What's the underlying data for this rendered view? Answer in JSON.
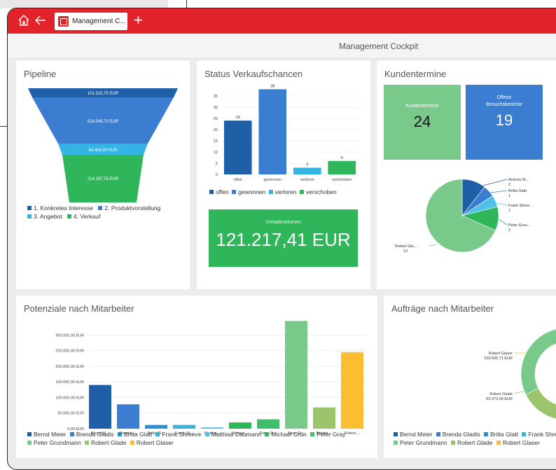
{
  "window": {
    "tab_label": "Management C...",
    "page_title": "Management Cockpit"
  },
  "colors": {
    "brand_red": "#e2232a",
    "dark_blue": "#1f5fa8",
    "mid_blue": "#3b7dd0",
    "cyan": "#33b4e3",
    "green": "#2fb55a",
    "light_green": "#79c98a",
    "olive_green": "#9cc46b",
    "orange": "#fbbd32"
  },
  "icons": [
    "home-icon",
    "back-arrow-icon",
    "app-tab-icon",
    "add-tab-icon"
  ],
  "pipeline": {
    "title": "Pipeline",
    "stages": [
      {
        "label": "101.315,75 EUR",
        "legend": "1. Konkretes Interesse"
      },
      {
        "label": "518.549,70 EUR",
        "legend": "2. Produktvorstellung"
      },
      {
        "label": "94.454,90 EUR",
        "legend": "3. Angebot"
      },
      {
        "label": "214.167,76 EUR",
        "legend": "4. Verkauf"
      }
    ]
  },
  "status": {
    "title": "Status Verkaufschancen"
  },
  "umsatz": {
    "label": "Umsatzvolumen",
    "value": "121.217,41 EUR"
  },
  "termine": {
    "title": "Kundentermine",
    "tile1_label": "Kundentermine",
    "tile1_value": "24",
    "tile2_label": "Offene Besuchsberichte",
    "tile2_value": "19",
    "pie_labels": [
      {
        "name": "Antonio M...",
        "value": "2"
      },
      {
        "name": "Britta Glatt",
        "value": "1"
      },
      {
        "name": "Frank Shree...",
        "value": "1"
      },
      {
        "name": "Peter Grun...",
        "value": "2"
      },
      {
        "name": "Robert Gla...",
        "value": "13"
      }
    ]
  },
  "potenziale": {
    "title": "Potenziale nach Mitarbeiter"
  },
  "auftraege": {
    "title": "Aufträge nach Mitarbeiter",
    "callout1_name": "Robert Glaser",
    "callout1_value": "239.605,71 EUR",
    "callout2_name": "Robert Glade",
    "callout2_value": "65.973,00 EUR",
    "legend": [
      {
        "name": "Bernd Meier",
        "color": "#1f5fa8"
      },
      {
        "name": "Brenda Gladis",
        "color": "#3b7dd0"
      },
      {
        "name": "Britta Glatt",
        "color": "#2b8fd8"
      },
      {
        "name": "Frank Shreeve",
        "color": "#33b4e3"
      },
      {
        "name": "Peter Grundmann",
        "color": "#79c98a"
      },
      {
        "name": "Robert Glade",
        "color": "#9cc46b"
      },
      {
        "name": "Robert Glaser",
        "color": "#fbbd32"
      }
    ]
  },
  "chart_data": [
    {
      "type": "bar",
      "title": "Status Verkaufschancen",
      "categories": [
        "offen",
        "gewonnen",
        "verloren",
        "verschoben"
      ],
      "values": [
        24,
        38,
        3,
        6
      ],
      "colors": [
        "#1f5fa8",
        "#3b7dd0",
        "#33b4e3",
        "#2fb55a"
      ],
      "yticks": [
        0,
        5,
        10,
        15,
        20,
        25,
        30,
        35
      ],
      "ylim": [
        0,
        40
      ],
      "legend": [
        "offen",
        "gewonnen",
        "verloren",
        "verschoben"
      ],
      "legend_position": "bottom"
    },
    {
      "type": "bar",
      "title": "Potenziale nach Mitarbeiter",
      "categories": [
        "Bernd M...",
        "Brenda ...",
        "Britta Gl...",
        "Frank Sh...",
        "Matthia...",
        "Michael ...",
        "Peter Gr...",
        "Peter Gr...",
        "Robert ...",
        "Robert ..."
      ],
      "values": [
        140000,
        78000,
        12000,
        12000,
        4000,
        20000,
        30000,
        345000,
        68000,
        245000
      ],
      "colors": [
        "#1f5fa8",
        "#3b7dd0",
        "#2b8fd8",
        "#33b4e3",
        "#4fc1e9",
        "#2fb55a",
        "#3fbf6a",
        "#79c98a",
        "#9cc46b",
        "#fbbd32"
      ],
      "yticks": [
        "0,00 EUR",
        "50.000,00 EUR",
        "100.000,00 EUR",
        "150.000,00 EUR",
        "200.000,00 EUR",
        "250.000,00 EUR",
        "300.000,00 EUR"
      ],
      "ylim": [
        0,
        350000
      ],
      "legend": [
        "Bernd Meier",
        "Brenda Gladis",
        "Britta Glatt",
        "Frank Shreeve",
        "Matthias Daumann",
        "Michael Grün",
        "Peter Gray",
        "Peter Grundmann",
        "Robert Glade",
        "Robert Glaser"
      ],
      "legend_position": "bottom"
    },
    {
      "type": "pie",
      "title": "Kundentermine",
      "labels": [
        "Antonio M...",
        "Britta Glatt",
        "Frank Shree...",
        "Peter Grun...",
        "Robert Gla..."
      ],
      "values": [
        2,
        1,
        1,
        2,
        13
      ],
      "colors": [
        "#1f5fa8",
        "#3b7dd0",
        "#4fc1e9",
        "#2fb55a",
        "#79c98a"
      ]
    },
    {
      "type": "pie",
      "title": "Aufträge nach Mitarbeiter",
      "labels": [
        "Bernd Meier",
        "Robert Glaser",
        "Robert Glade",
        "Peter Grundmann"
      ],
      "values": [
        8000,
        239605.71,
        65973.0,
        150000
      ],
      "colors": [
        "#1f5fa8",
        "#fbbd32",
        "#9cc46b",
        "#79c98a"
      ]
    }
  ]
}
